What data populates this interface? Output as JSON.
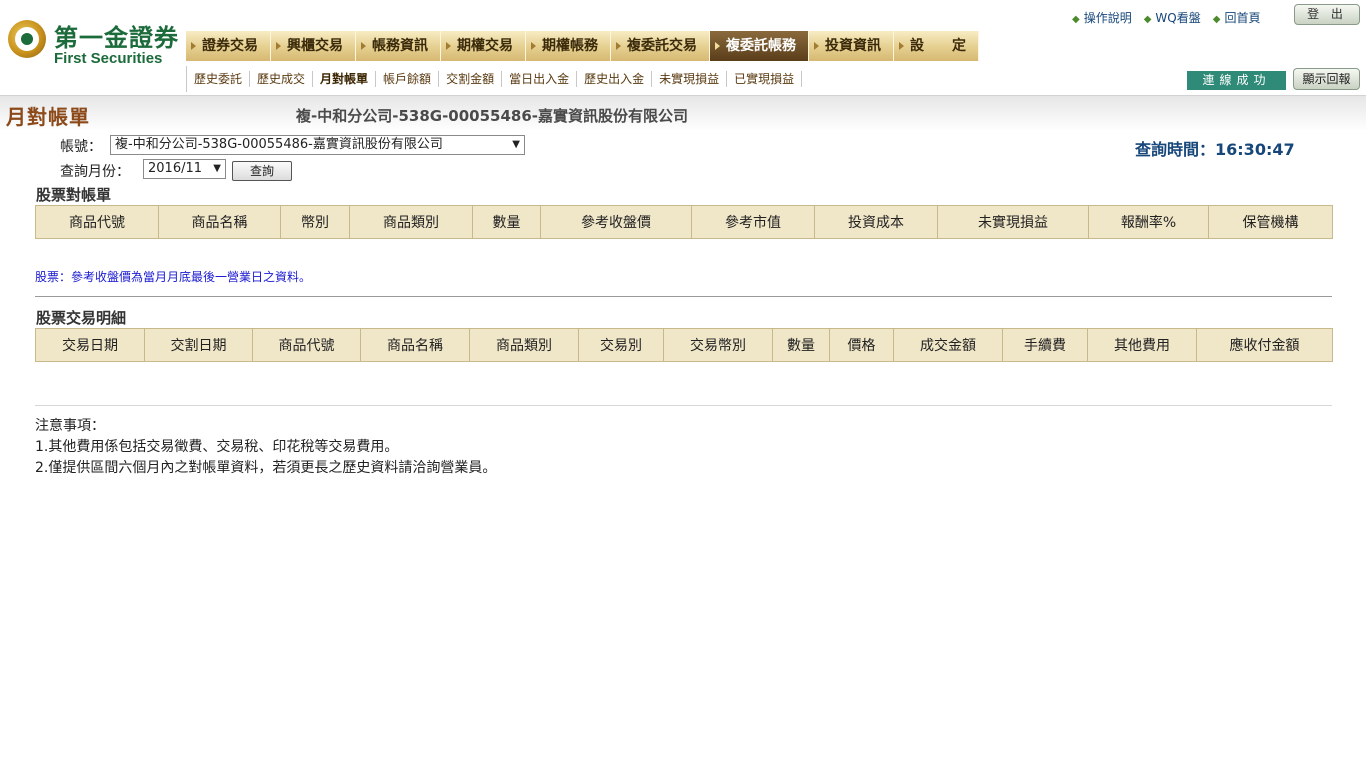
{
  "brand": {
    "name_cn": "第一金證券",
    "name_en": "First Securities"
  },
  "top_links": [
    {
      "label": "操作說明"
    },
    {
      "label": "WQ看盤"
    },
    {
      "label": "回首頁"
    }
  ],
  "logout_label": "登 出",
  "main_nav": [
    {
      "label": "證券交易",
      "active": false
    },
    {
      "label": "興櫃交易",
      "active": false
    },
    {
      "label": "帳務資訊",
      "active": false
    },
    {
      "label": "期權交易",
      "active": false
    },
    {
      "label": "期權帳務",
      "active": false
    },
    {
      "label": "複委託交易",
      "active": false
    },
    {
      "label": "複委託帳務",
      "active": true
    },
    {
      "label": "投資資訊",
      "active": false
    },
    {
      "label": "設　　定",
      "active": false
    }
  ],
  "sub_nav": [
    {
      "label": "歷史委託",
      "active": false
    },
    {
      "label": "歷史成交",
      "active": false
    },
    {
      "label": "月對帳單",
      "active": true
    },
    {
      "label": "帳戶餘額",
      "active": false
    },
    {
      "label": "交割金額",
      "active": false
    },
    {
      "label": "當日出入金",
      "active": false
    },
    {
      "label": "歷史出入金",
      "active": false
    },
    {
      "label": "未實現損益",
      "active": false
    },
    {
      "label": "已實現損益",
      "active": false
    }
  ],
  "connection_status": "連線成功",
  "show_reply_label": "顯示回報",
  "page": {
    "title": "月對帳單",
    "account_title": "複-中和分公司-538G-00055486-嘉實資訊股份有限公司"
  },
  "form": {
    "account_label": "帳號：",
    "account_value": "複-中和分公司-538G-00055486-嘉實資訊股份有限公司",
    "month_label": "查詢月份：",
    "month_value": "2016/11",
    "query_button": "查詢",
    "query_time_label": "查詢時間：",
    "query_time": "16:30:47"
  },
  "stock_statement": {
    "title": "股票對帳單",
    "columns": [
      "商品代號",
      "商品名稱",
      "幣別",
      "商品類別",
      "數量",
      "參考收盤價",
      "參考市值",
      "投資成本",
      "未實現損益",
      "報酬率%",
      "保管機構"
    ],
    "note": "股票：參考收盤價為當月月底最後一營業日之資料。"
  },
  "stock_transactions": {
    "title": "股票交易明細",
    "columns": [
      "交易日期",
      "交割日期",
      "商品代號",
      "商品名稱",
      "商品類別",
      "交易別",
      "交易幣別",
      "數量",
      "價格",
      "成交金額",
      "手續費",
      "其他費用",
      "應收付金額"
    ]
  },
  "notes": {
    "title": "注意事項：",
    "items": [
      "1.其他費用係包括交易徵費、交易稅、印花稅等交易費用。",
      "2.僅提供區間六個月內之對帳單資料，若須更長之歷史資料請洽詢營業員。"
    ]
  }
}
